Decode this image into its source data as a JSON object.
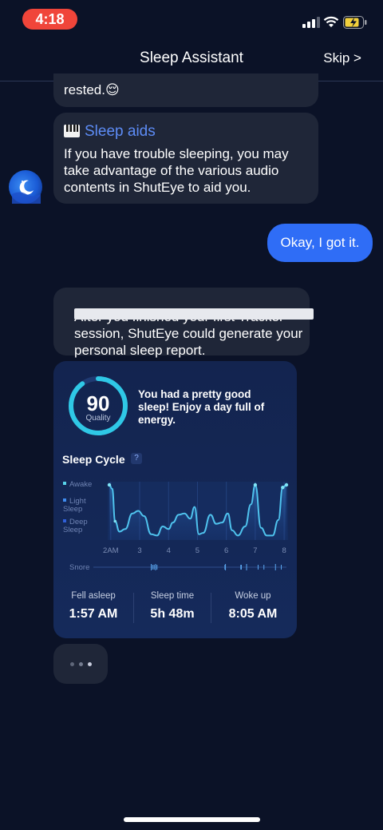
{
  "status_bar": {
    "time": "4:18"
  },
  "nav": {
    "title": "Sleep Assistant",
    "skip_label": "Skip >"
  },
  "messages": {
    "partial_text": "rested.😌",
    "sleep_aids_title": "Sleep aids",
    "sleep_aids_body": "If you have trouble sleeping, you may take advantage of the various audio contents in ShutEye to aid you.",
    "user_reply": "Okay, I got it.",
    "report_intro": "After you finished your first Tracker session, ShutEye could generate your personal sleep report."
  },
  "report": {
    "score": "90",
    "score_label": "Quality",
    "summary": "You had a pretty good sleep! Enjoy a day full of energy.",
    "cycle_title": "Sleep Cycle",
    "help_glyph": "?",
    "legend": [
      "Awake",
      "Light Sleep",
      "Deep Sleep"
    ],
    "snore_label": "Snore",
    "stats": [
      {
        "label": "Fell asleep",
        "value": "1:57 AM"
      },
      {
        "label": "Sleep time",
        "value": "5h 48m"
      },
      {
        "label": "Woke up",
        "value": "8:05 AM"
      }
    ],
    "accent_color": "#2fc8e6"
  },
  "chart_data": {
    "type": "line",
    "x_ticks": [
      "2AM",
      "3",
      "4",
      "5",
      "6",
      "7",
      "8"
    ],
    "y_levels": [
      "Awake",
      "Light Sleep",
      "Deep Sleep"
    ],
    "x_range": [
      1.95,
      8.08
    ],
    "y_range": [
      0,
      2
    ],
    "series": [
      {
        "values": [
          [
            1.95,
            2.0
          ],
          [
            2.05,
            1.85
          ],
          [
            2.15,
            0.6
          ],
          [
            2.3,
            0.2
          ],
          [
            2.5,
            0.3
          ],
          [
            2.75,
            0.9
          ],
          [
            2.95,
            1.0
          ],
          [
            3.15,
            0.8
          ],
          [
            3.4,
            0.1
          ],
          [
            3.6,
            0.05
          ],
          [
            3.8,
            0.4
          ],
          [
            4.0,
            0.3
          ],
          [
            4.15,
            0.55
          ],
          [
            4.35,
            0.85
          ],
          [
            4.55,
            0.9
          ],
          [
            4.75,
            0.7
          ],
          [
            4.9,
            1.15
          ],
          [
            5.05,
            0.1
          ],
          [
            5.2,
            0.15
          ],
          [
            5.45,
            0.85
          ],
          [
            5.65,
            0.5
          ],
          [
            5.85,
            0.55
          ],
          [
            6.05,
            0.9
          ],
          [
            6.2,
            0.25
          ],
          [
            6.4,
            0.05
          ],
          [
            6.65,
            0.4
          ],
          [
            6.85,
            1.25
          ],
          [
            7.0,
            2.0
          ],
          [
            7.2,
            0.35
          ],
          [
            7.4,
            0.05
          ],
          [
            7.6,
            0.05
          ],
          [
            7.8,
            0.65
          ],
          [
            7.95,
            1.9
          ],
          [
            8.08,
            2.0
          ]
        ]
      }
    ],
    "snore_events": [
      3.4,
      3.45,
      3.5,
      3.55,
      3.6,
      5.95,
      5.97,
      6.5,
      6.52,
      6.7,
      7.1,
      7.3,
      7.7,
      7.9
    ]
  }
}
